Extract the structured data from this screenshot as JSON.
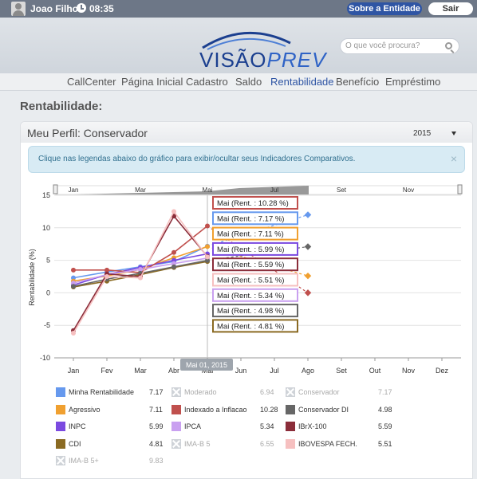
{
  "topbar": {
    "user": "Joao Filho",
    "time": "08:35",
    "about_label": "Sobre a Entidade",
    "logout_label": "Sair"
  },
  "brand": {
    "left": "VISÃO",
    "right": "PREV"
  },
  "search": {
    "placeholder": "O que você procura?"
  },
  "nav": {
    "items": [
      "CallCenter",
      "Página Inicial",
      "Cadastro",
      "Saldo",
      "Rentabilidade",
      "Benefício",
      "Empréstimo"
    ],
    "active": "Rentabilidade"
  },
  "page": {
    "title": "Rentabilidade:"
  },
  "panel": {
    "title": "Meu Perfil: Conservador",
    "year": "2015"
  },
  "alert": {
    "message": "Clique nas legendas abaixo do gráfico para exibir/ocultar seus Indicadores Comparativos."
  },
  "chart_data": {
    "type": "line",
    "ylabel": "Rentabilidade (%)",
    "ylim": [
      -10,
      15
    ],
    "yticks": [
      "-10",
      "-5",
      "0",
      "5",
      "10",
      "15"
    ],
    "categories": [
      "Jan",
      "Fev",
      "Mar",
      "Abr",
      "Mai",
      "Jun",
      "Jul",
      "Ago",
      "Set",
      "Out",
      "Nov",
      "Dez"
    ],
    "navigator_labels": [
      "Jan",
      "Mar",
      "Mai",
      "Jul",
      "Set",
      "Nov"
    ],
    "crosshair_label": "Mai 01, 2015",
    "tooltips": [
      "Mai (Rent. : 10.28 %)",
      "Mai (Rent. : 7.17 %)",
      "Mai (Rent. : 7.11 %)",
      "Mai (Rent. : 5.99 %)",
      "Mai (Rent. : 5.59 %)",
      "Mai (Rent. : 5.51 %)",
      "Mai (Rent. : 5.34 %)",
      "Mai (Rent. : 4.98 %)",
      "Mai (Rent. : 4.81 %)"
    ],
    "tooltip_colors": [
      "#c0504d",
      "#6699ee",
      "#f0a030",
      "#7b4ae0",
      "#8b2d3a",
      "#f6c0c0",
      "#c9a0f0",
      "#666666",
      "#8a6a22"
    ],
    "series": [
      {
        "name": "Minha Rentabilidade",
        "color": "#6699ee",
        "values": [
          2.3,
          3.2,
          4.0,
          4.8,
          7.17,
          null,
          null,
          12.0,
          null,
          null,
          null,
          null
        ]
      },
      {
        "name": "Agressivo",
        "color": "#f0a030",
        "values": [
          1.8,
          2.6,
          3.6,
          5.4,
          7.11,
          null,
          null,
          2.6,
          null,
          null,
          null,
          null
        ]
      },
      {
        "name": "INPC",
        "color": "#7b4ae0",
        "values": [
          1.2,
          2.8,
          3.9,
          5.0,
          5.99,
          null,
          null,
          null,
          null,
          null,
          null,
          null
        ]
      },
      {
        "name": "CDI",
        "color": "#8a6a22",
        "values": [
          0.9,
          1.8,
          2.8,
          3.9,
          4.81,
          null,
          null,
          null,
          null,
          null,
          null,
          null
        ]
      },
      {
        "name": "Indexado a Inflacao",
        "color": "#c0504d",
        "values": [
          3.5,
          3.5,
          3.1,
          6.2,
          10.28,
          null,
          null,
          0.0,
          null,
          null,
          null,
          null
        ]
      },
      {
        "name": "IPCA",
        "color": "#c9a0f0",
        "values": [
          1.5,
          2.8,
          3.6,
          4.5,
          5.34,
          null,
          null,
          null,
          null,
          null,
          null,
          null
        ]
      },
      {
        "name": "Conservador DI",
        "color": "#666666",
        "values": [
          1.0,
          2.1,
          3.0,
          4.0,
          4.98,
          null,
          null,
          7.1,
          null,
          null,
          null,
          null
        ]
      },
      {
        "name": "IBrX-100",
        "color": "#8b2d3a",
        "values": [
          -5.8,
          2.9,
          2.5,
          11.8,
          5.59,
          null,
          null,
          null,
          null,
          null,
          null,
          null
        ]
      },
      {
        "name": "IBOVESPA FECH.",
        "color": "#f6c0c0",
        "values": [
          -6.2,
          2.5,
          2.3,
          12.5,
          5.51,
          null,
          null,
          null,
          null,
          null,
          null,
          null
        ]
      }
    ]
  },
  "legend": [
    {
      "label": "Minha Rentabilidade",
      "value": "7.17",
      "color": "#6699ee",
      "hidden": false
    },
    {
      "label": "Moderado",
      "value": "6.94",
      "color": "#cfd3d8",
      "hidden": true
    },
    {
      "label": "Conservador",
      "value": "7.17",
      "color": "#cfd3d8",
      "hidden": true
    },
    {
      "label": "Agressivo",
      "value": "7.11",
      "color": "#f0a030",
      "hidden": false
    },
    {
      "label": "Indexado a Inflacao",
      "value": "10.28",
      "color": "#c0504d",
      "hidden": false
    },
    {
      "label": "Conservador DI",
      "value": "4.98",
      "color": "#666666",
      "hidden": false
    },
    {
      "label": "INPC",
      "value": "5.99",
      "color": "#7b4ae0",
      "hidden": false
    },
    {
      "label": "IPCA",
      "value": "5.34",
      "color": "#c9a0f0",
      "hidden": false
    },
    {
      "label": "IBrX-100",
      "value": "5.59",
      "color": "#8b2d3a",
      "hidden": false
    },
    {
      "label": "CDI",
      "value": "4.81",
      "color": "#8a6a22",
      "hidden": false
    },
    {
      "label": "IMA-B 5",
      "value": "6.55",
      "color": "#cfd3d8",
      "hidden": true
    },
    {
      "label": "IBOVESPA FECH.",
      "value": "5.51",
      "color": "#f6c0c0",
      "hidden": false
    },
    {
      "label": "IMA-B 5+",
      "value": "9.83",
      "color": "#cfd3d8",
      "hidden": true
    }
  ]
}
